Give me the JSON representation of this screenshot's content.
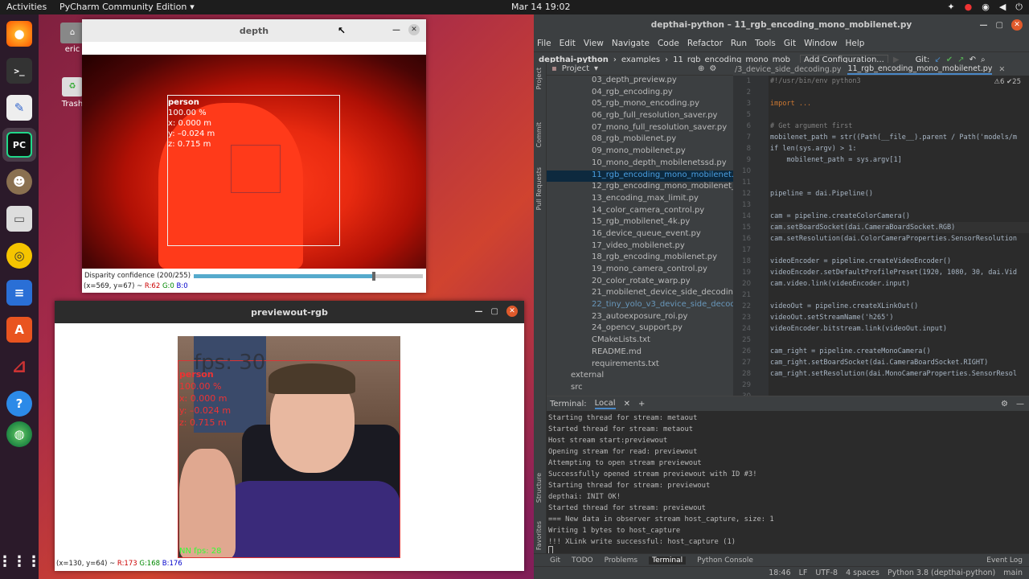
{
  "topbar": {
    "activities": "Activities",
    "app": "PyCharm Community Edition",
    "clock": "Mar 14  19:02"
  },
  "desktop": {
    "home_label": "eric",
    "trash_label": "Trash"
  },
  "depth_window": {
    "title": "depth",
    "slider_label": "Disparity confidence (200/255)",
    "status": "(x=569, y=67) ~ ",
    "r": "R:62",
    "g": "G:0",
    "b": "B:0",
    "det_label": "person",
    "det_conf": "100.00 %",
    "det_x": "x:  0.000  m",
    "det_y": "y:  –0.024  m",
    "det_z": "z:  0.715  m"
  },
  "rgb_window": {
    "title": "previewout-rgb",
    "status": "(x=130, y=64) ~ ",
    "r": "R:173",
    "g": "G:168",
    "b": "B:176",
    "fps": "fps: 30",
    "nn_fps": "NN fps: 28",
    "det_label": "person",
    "det_conf": "100.00 %",
    "det_x": "x:  0.000 m",
    "det_y": "y:  –0.024 m",
    "det_z": "z:  0.715 m"
  },
  "ide": {
    "title": "depthai-python – 11_rgb_encoding_mono_mobilenet.py",
    "menu": [
      "File",
      "Edit",
      "View",
      "Navigate",
      "Code",
      "Refactor",
      "Run",
      "Tools",
      "Git",
      "Window",
      "Help"
    ],
    "breadcrumb": [
      "depthai-python",
      "examples",
      "11_rgb_encoding_mono_mob"
    ],
    "add_config": "Add Configuration...",
    "git": "Git:",
    "project_label": "Project",
    "tree": [
      "03_depth_preview.py",
      "04_rgb_encoding.py",
      "05_rgb_mono_encoding.py",
      "06_rgb_full_resolution_saver.py",
      "07_mono_full_resolution_saver.py",
      "08_rgb_mobilenet.py",
      "09_mono_mobilenet.py",
      "10_mono_depth_mobilenetssd.py",
      "11_rgb_encoding_mono_mobilenet.py",
      "12_rgb_encoding_mono_mobilenet_de",
      "13_encoding_max_limit.py",
      "14_color_camera_control.py",
      "15_rgb_mobilenet_4k.py",
      "16_device_queue_event.py",
      "17_video_mobilenet.py",
      "18_rgb_encoding_mobilenet.py",
      "19_mono_camera_control.py",
      "20_color_rotate_warp.py",
      "21_mobilenet_device_side_decoding.py",
      "22_tiny_yolo_v3_device_side_decoding.",
      "23_autoexposure_roi.py",
      "24_opencv_support.py",
      "CMakeLists.txt",
      "README.md",
      "requirements.txt",
      "external",
      "src"
    ],
    "tabs": [
      "/3_device_side_decoding.py",
      "11_rgb_encoding_mono_mobilenet.py"
    ],
    "warn": "⚠6  ✔25",
    "line_numbers": [
      "1",
      "2",
      "3",
      "5",
      "6",
      "7",
      "8",
      "9",
      "10",
      "11",
      "12",
      "13",
      "14",
      "15",
      "16",
      "17",
      "18",
      "19",
      "20",
      "21",
      "22",
      "23",
      "24",
      "25",
      "26",
      "27",
      "28",
      "29",
      "30",
      "31"
    ],
    "code": [
      "#!/usr/bin/env python3",
      "",
      "import ...",
      "",
      "# Get argument first",
      "mobilenet_path = str((Path(__file__).parent / Path('models/m",
      "if len(sys.argv) > 1:",
      "    mobilenet_path = sys.argv[1]",
      "",
      "",
      "pipeline = dai.Pipeline()",
      "",
      "cam = pipeline.createColorCamera()",
      "cam.setBoardSocket(dai.CameraBoardSocket.RGB)",
      "cam.setResolution(dai.ColorCameraProperties.SensorResolution",
      "",
      "videoEncoder = pipeline.createVideoEncoder()",
      "videoEncoder.setDefaultProfilePreset(1920, 1080, 30, dai.Vid",
      "cam.video.link(videoEncoder.input)",
      "",
      "videoOut = pipeline.createXLinkOut()",
      "videoOut.setStreamName('h265')",
      "videoEncoder.bitstream.link(videoOut.input)",
      "",
      "cam_right = pipeline.createMonoCamera()",
      "cam_right.setBoardSocket(dai.CameraBoardSocket.RIGHT)",
      "cam_right.setResolution(dai.MonoCameraProperties.SensorResol"
    ],
    "terminal_label": "Terminal:",
    "terminal_tab": "Local",
    "terminal": [
      "Starting thread for stream: metaout",
      "Started thread for stream: metaout",
      "Host stream start:previewout",
      "Opening stream for read: previewout",
      "Attempting to open stream previewout",
      "Successfully opened stream previewout with ID #3!",
      "Starting thread for stream: previewout",
      "depthai: INIT OK!",
      "Started thread for stream: previewout",
      "=== New data in observer stream host_capture, size: 1",
      "Writing 1 bytes to host_capture",
      "!!! XLink write successful: host_capture (1)"
    ],
    "bottom_tabs": [
      "Git",
      "TODO",
      "Problems",
      "Terminal",
      "Python Console"
    ],
    "event_log": "Event Log",
    "side_tabs": [
      "Project",
      "Commit",
      "Pull Requests",
      "Structure",
      "Favorites"
    ],
    "status": [
      "18:46",
      "LF",
      "UTF-8",
      "4 spaces",
      "Python 3.8 (depthai-python)",
      "main"
    ]
  }
}
